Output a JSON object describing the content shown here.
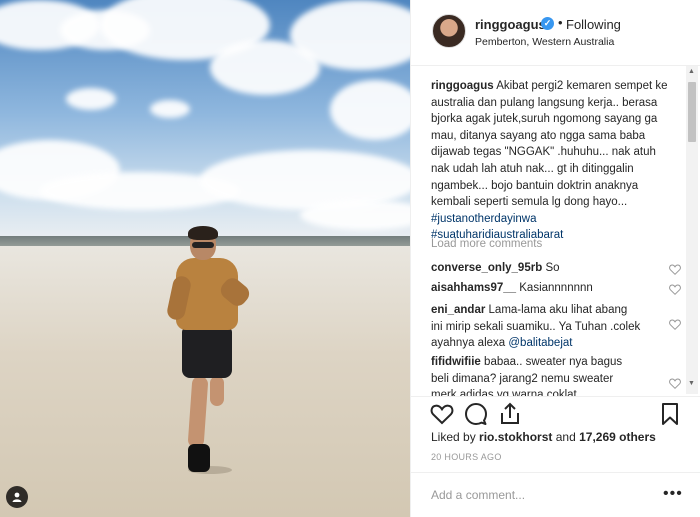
{
  "post": {
    "username": "ringgoagus",
    "follow_status": "Following",
    "location": "Pemberton, Western Australia",
    "caption_user": "ringgoagus",
    "caption_text": "Akibat pergi2 kemaren sempet ke australia dan pulang langsung kerja.. berasa bjorka agak jutek,suruh ngomong sayang ga mau, ditanya sayang ato ngga sama baba dijawab tegas \"NGGAK\" .huhuhu... nak atuh nak udah lah atuh nak... gt ih ditinggalin ngambek... bojo bantuin doktrin anaknya kembali seperti semula lg dong hayo...",
    "hashtags": [
      "#justanotherdayinwa",
      "#suatuharidiaustraliabarat"
    ],
    "load_more": "Load more comments",
    "comments": [
      {
        "user": "converse_only_95rb",
        "text": "So"
      },
      {
        "user": "aisahhams97__",
        "text": "Kasiannnnnnn"
      },
      {
        "user": "eni_andar",
        "text": "Lama-lama aku lihat abang ini mirip sekali suamiku.. Ya Tuhan .colek ayahnya alexa",
        "mention": "@balitabejat"
      },
      {
        "user": "fifidwifiie",
        "text": "babaa.. sweater nya bagus beli dimana? jarang2 nemu sweater merk adidas yg warna coklat"
      }
    ],
    "likes_prefix": "Liked by",
    "liked_by": "rio.stokhorst",
    "likes_and": "and",
    "likes_count": "17,269 others",
    "timestamp": "20 HOURS AGO",
    "comment_placeholder": "Add a comment...",
    "more_options": "•••"
  },
  "icons": [
    "heart-icon",
    "comment-icon",
    "share-icon",
    "bookmark-icon",
    "verified-badge-icon",
    "user-tag-icon"
  ],
  "colors": {
    "link": "#003569",
    "verified": "#3897f0",
    "muted": "#999999",
    "text": "#262626"
  }
}
